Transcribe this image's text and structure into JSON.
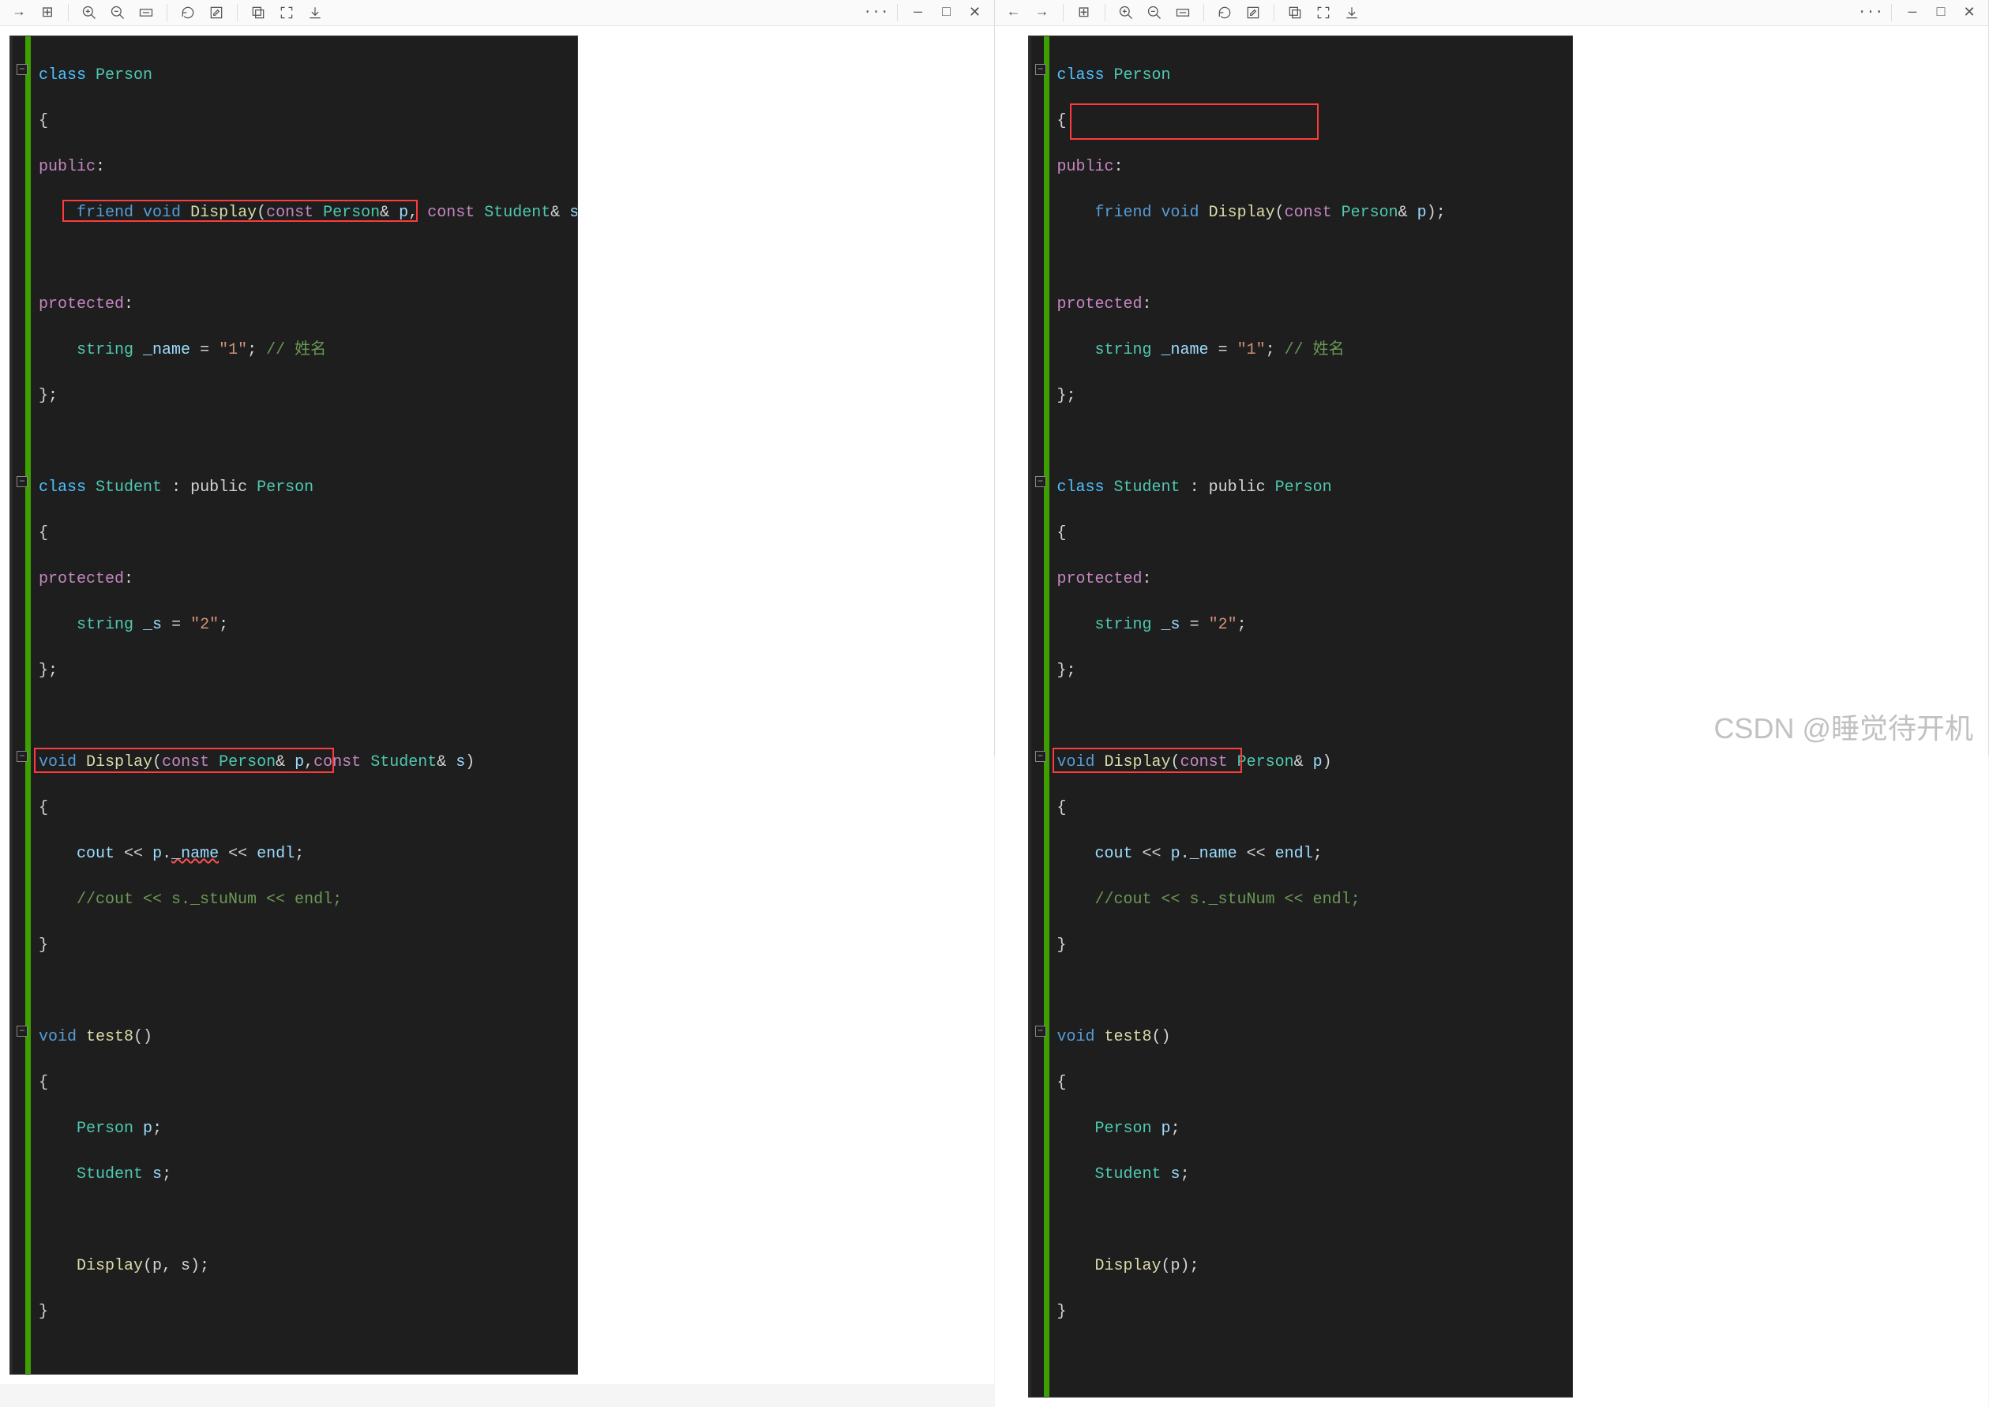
{
  "toolbar": {
    "back": "←",
    "forward": "→",
    "grid": "⊞",
    "zoom_in": "+",
    "zoom_out": "−",
    "fit": "⟷",
    "rotate": "↻",
    "edit": "✎",
    "copy": "⧉",
    "fullscreen": "⤢",
    "download": "⤓",
    "more": "···",
    "minimize": "—",
    "maximize": "□",
    "close": "✕"
  },
  "left": {
    "code": {
      "class_person": "class",
      "person_name": "Person",
      "brace_open": "{",
      "public_kw": "public",
      "friend_kw": "friend",
      "void_kw": "void",
      "display_name": "Display",
      "const_kw": "const",
      "param_p": "p",
      "param_s": "s",
      "student_name": "Student",
      "protected_kw": "protected",
      "string_t": "string",
      "name_member": "_name",
      "name_val": "\"1\"",
      "name_comment": "// 姓名",
      "brace_close": "};",
      "class_student": "class",
      "inherit": ": public",
      "s_member": "_s",
      "s_val": "\"2\"",
      "func_brace_open": "{",
      "cout": "cout",
      "endl": "endl",
      "ll": "<<",
      "dot_name": "._name",
      "comment_line": "//cout << s._stuNum << endl;",
      "func_brace_close": "}",
      "test8_name": "test8",
      "person_decl": "Person p;",
      "student_decl": "Student s;",
      "display_call": "Display(p, s);",
      "friend_line": "friend void Display(const Person& p, const Student& s);",
      "display_sig": "void Display(const Person& p,const Student& s)"
    }
  },
  "right": {
    "code": {
      "friend_line": "friend void Display(const Person& p);",
      "display_sig": "void Display(const Person& p)",
      "display_call": "Display(p);"
    }
  },
  "watermark": "CSDN @睡觉待开机"
}
